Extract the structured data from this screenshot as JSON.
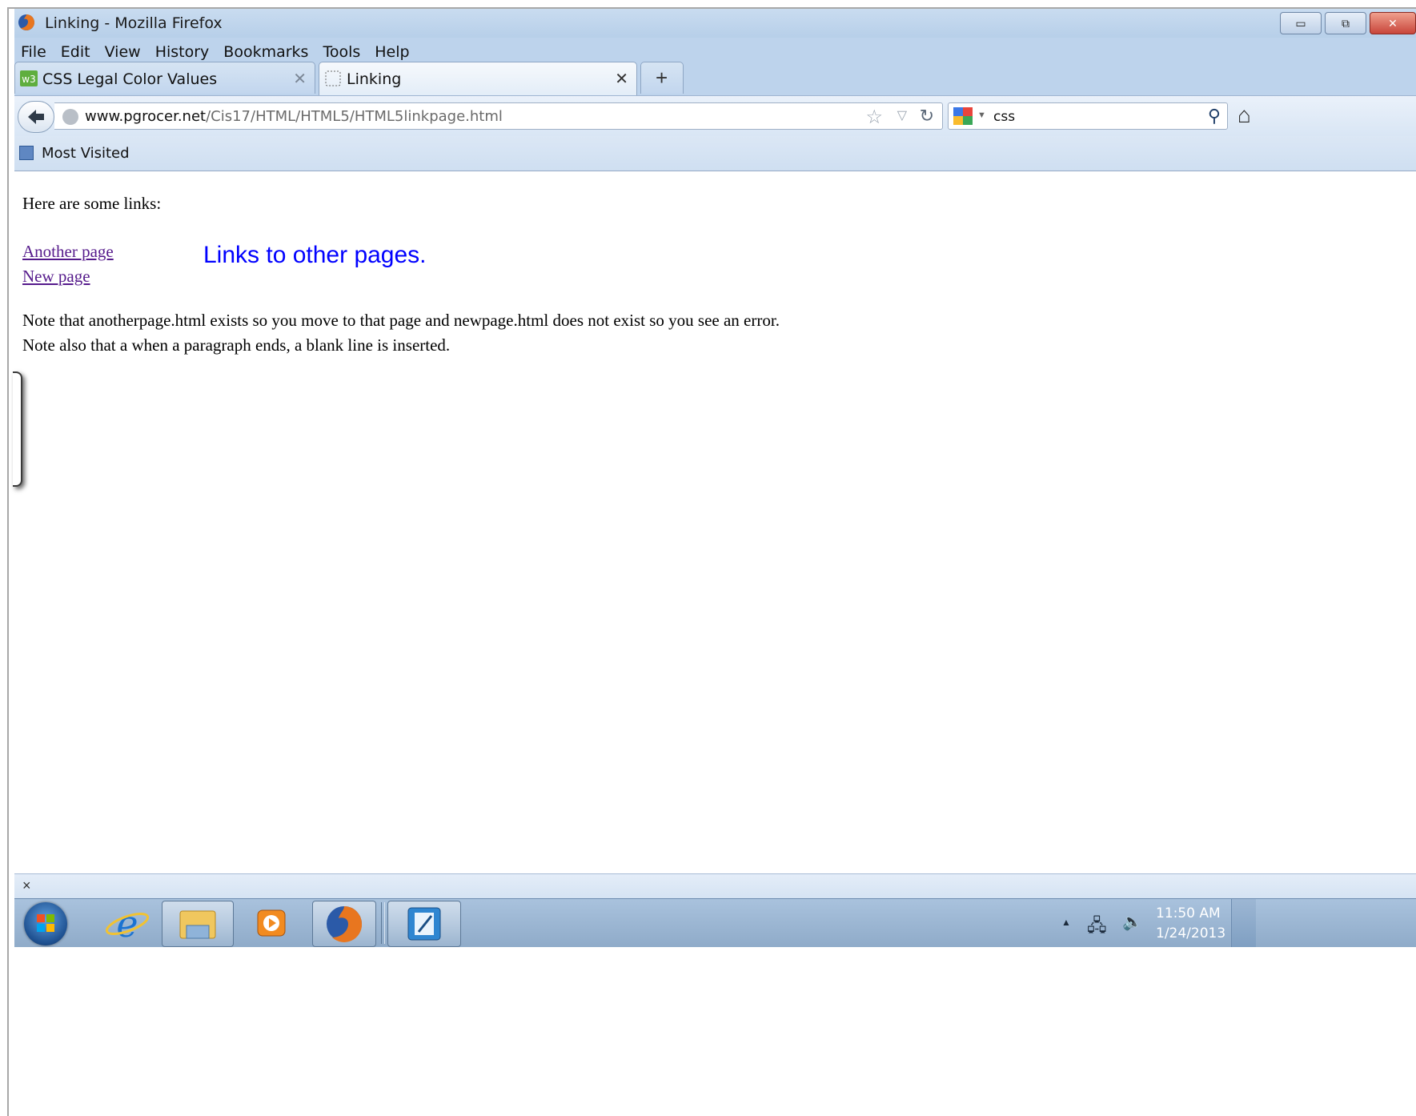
{
  "window": {
    "title": "Linking - Mozilla Firefox",
    "controls": {
      "minimize": "▭",
      "restore": "⧉",
      "close": "✕"
    }
  },
  "menu": [
    "File",
    "Edit",
    "View",
    "History",
    "Bookmarks",
    "Tools",
    "Help"
  ],
  "tabs": [
    {
      "label": "CSS Legal Color Values",
      "state": "inactive",
      "icon": "w3-favicon"
    },
    {
      "label": "Linking",
      "state": "active",
      "icon": "blank-page-favicon"
    }
  ],
  "new_tab_label": "+",
  "nav": {
    "url_host": "www.pgrocer.net",
    "url_path": "/Cis17/HTML/HTML5/HTML5linkpage.html",
    "search_value": "css"
  },
  "bookmarks_bar": {
    "items": [
      "Most Visited"
    ]
  },
  "page": {
    "intro": "Here are some links:",
    "links": [
      "Another page",
      "New page"
    ],
    "annotation": "Links to other pages.",
    "notes": [
      "Note that anotherpage.html exists so you move to that page and newpage.html does not exist so you see an error.",
      "Note also that a when a paragraph ends, a blank line is inserted."
    ],
    "link_color": "#551a8b",
    "annotation_color": "#0000ff"
  },
  "findbar": {
    "close_label": "×"
  },
  "taskbar": {
    "apps": [
      "start-orb",
      "internet-explorer-icon",
      "file-explorer-icon",
      "media-player-icon",
      "firefox-icon",
      "notepad-icon"
    ],
    "time": "11:50 AM",
    "date": "1/24/2013"
  }
}
